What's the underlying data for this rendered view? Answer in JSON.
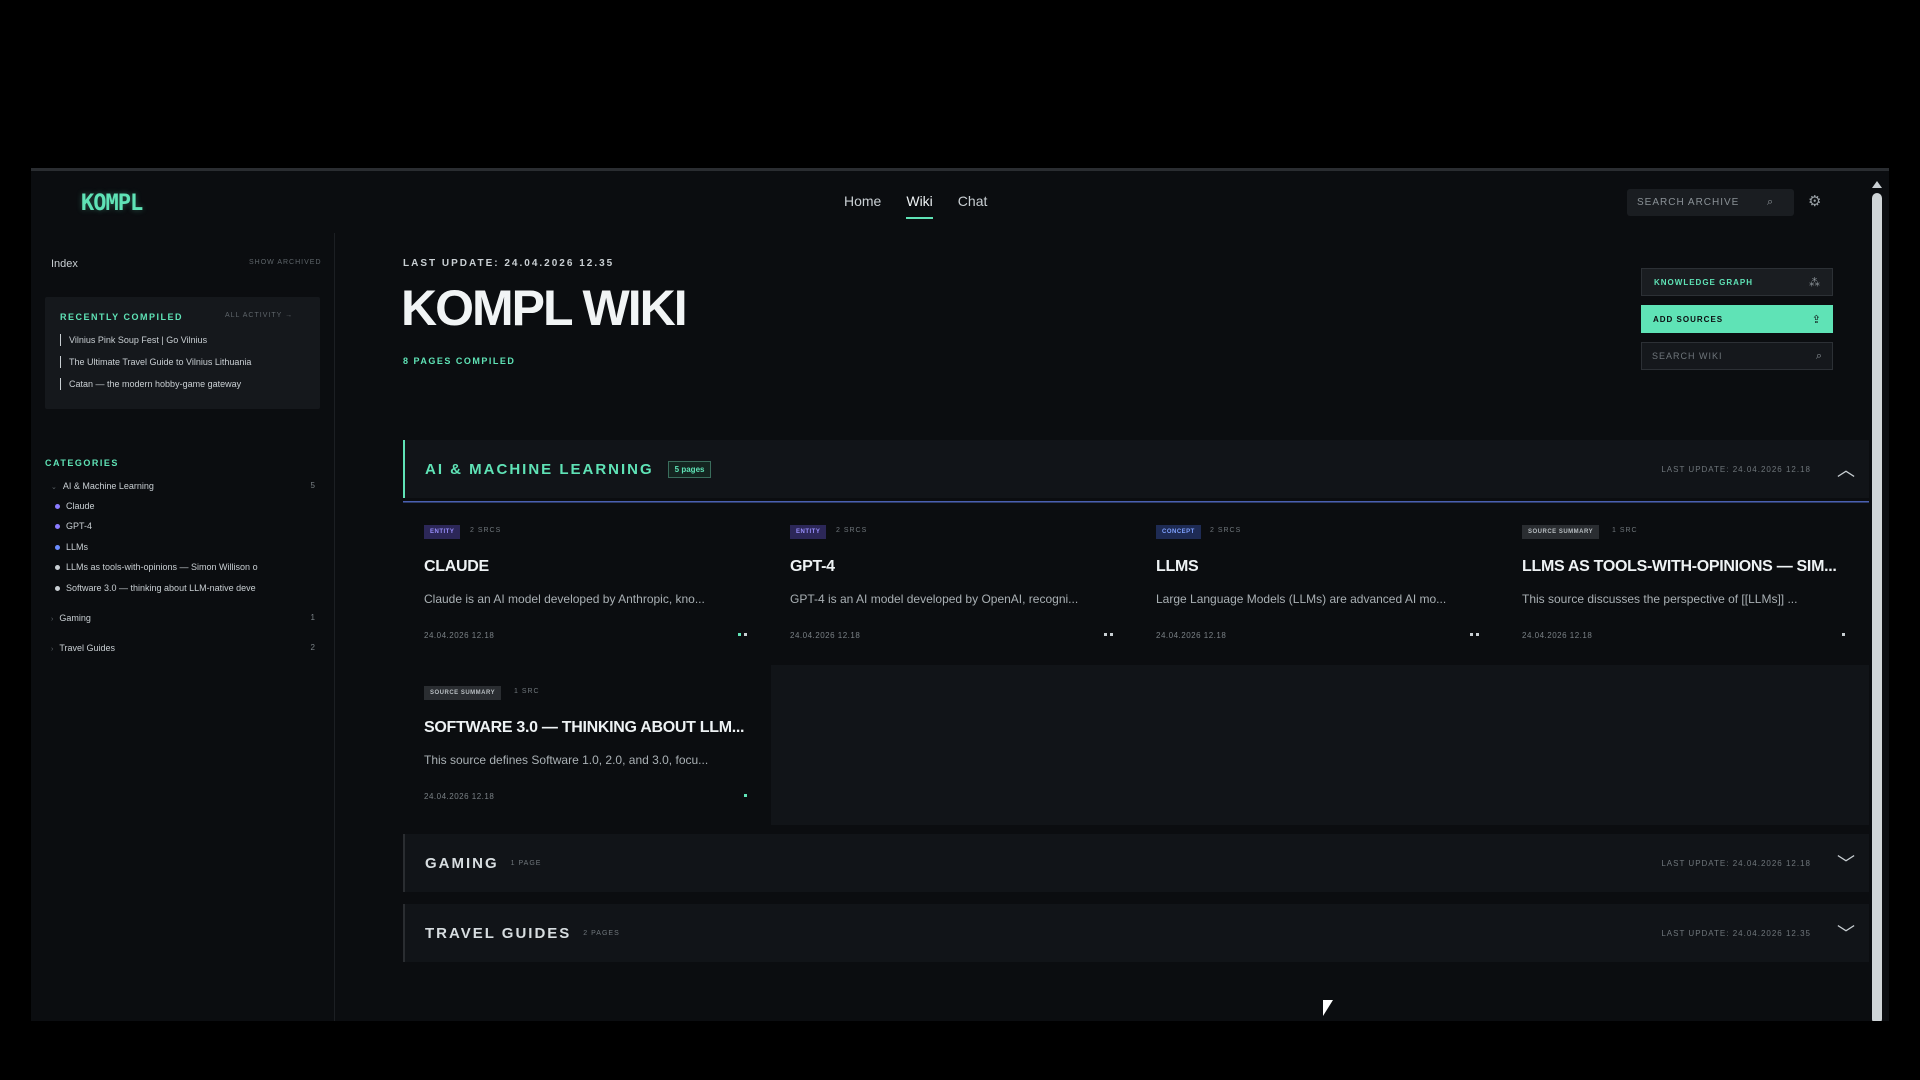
{
  "app": {
    "logo": "KOMPL",
    "nav": [
      "Home",
      "Wiki",
      "Chat"
    ],
    "search_archive_placeholder": "SEARCH ARCHIVE",
    "search_icon": "search-icon",
    "settings_icon": "gear-icon"
  },
  "sidebar": {
    "index_label": "Index",
    "show_archived": "SHOW ARCHIVED",
    "recent_title": "RECENTLY COMPILED",
    "recent_all": "ALL ACTIVITY →",
    "recent_items": [
      "Vilnius Pink Soup Fest | Go Vilnius",
      "The Ultimate Travel Guide to Vilnius Lithuania",
      "Catan — the modern hobby-game gateway"
    ],
    "categories_title": "CATEGORIES",
    "categories": [
      {
        "label": "AI & Machine Learning",
        "count": "5"
      },
      {
        "label": "Gaming",
        "count": "1"
      },
      {
        "label": "Travel Guides",
        "count": "2"
      }
    ],
    "ai_items": [
      {
        "label": "Claude",
        "color": "#8a7bff"
      },
      {
        "label": "GPT-4",
        "color": "#8a7bff"
      },
      {
        "label": "LLMs",
        "color": "#6b8cff"
      },
      {
        "label": "LLMs as tools-with-opinions — Simon Willison o",
        "color": "#c9cfd3"
      },
      {
        "label": "Software 3.0 — thinking about LLM-native deve",
        "color": "#c9cfd3"
      }
    ]
  },
  "main": {
    "last_update": "LAST UPDATE: 24.04.2026 12.35",
    "title": "KOMPL WIKI",
    "pages_compiled": "8 PAGES COMPILED",
    "btn_knowledge_graph": "KNOWLEDGE GRAPH",
    "btn_add_sources": "ADD SOURCES",
    "search_wiki_placeholder": "SEARCH WIKI",
    "sections": [
      {
        "name": "AI & MACHINE LEARNING",
        "count": "5 pages",
        "update": "LAST UPDATE: 24.04.2026 12.18"
      },
      {
        "name": "GAMING",
        "count": "1 PAGE",
        "update": "LAST UPDATE: 24.04.2026 12.18"
      },
      {
        "name": "TRAVEL GUIDES",
        "count": "2 PAGES",
        "update": "LAST UPDATE: 24.04.2026 12.35"
      }
    ],
    "cards": [
      {
        "tag": "ENTITY",
        "srcs": "2 SRCS",
        "title": "CLAUDE",
        "desc": "Claude is an AI model developed by Anthropic, kno...",
        "date": "24.04.2026 12.18"
      },
      {
        "tag": "ENTITY",
        "srcs": "2 SRCS",
        "title": "GPT-4",
        "desc": "GPT-4 is an AI model developed by OpenAI, recogni...",
        "date": "24.04.2026 12.18"
      },
      {
        "tag": "CONCEPT",
        "srcs": "2 SRCS",
        "title": "LLMS",
        "desc": "Large Language Models (LLMs) are advanced AI mo...",
        "date": "24.04.2026 12.18"
      },
      {
        "tag": "SOURCE SUMMARY",
        "srcs": "1 SRC",
        "title": "LLMS AS TOOLS-WITH-OPINIONS — SIM...",
        "desc": "This source discusses the perspective of [[LLMs]] ...",
        "date": "24.04.2026 12.18"
      },
      {
        "tag": "SOURCE SUMMARY",
        "srcs": "1 SRC",
        "title": "SOFTWARE 3.0 — THINKING ABOUT LLM...",
        "desc": "This source defines Software 1.0, 2.0, and 3.0, focu...",
        "date": "24.04.2026 12.18"
      }
    ]
  },
  "colors": {
    "accent": "#5fe3b6",
    "background": "#0b0d10",
    "entity": "#9a90ff",
    "concept": "#7ea1ff"
  }
}
